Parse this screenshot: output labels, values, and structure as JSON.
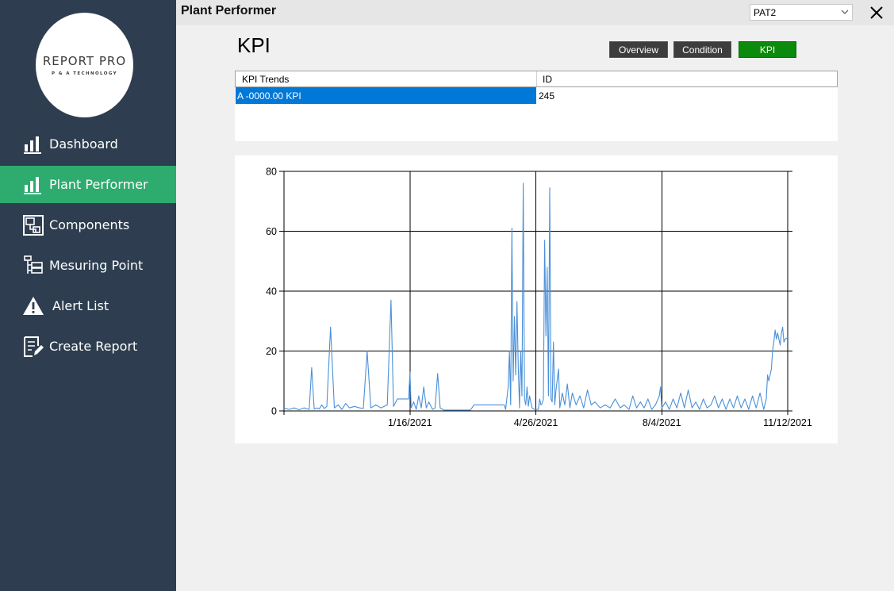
{
  "sidebar": {
    "logo": {
      "main": "REPORT PRO",
      "sub": "P & A TECHNOLOGY"
    },
    "items": [
      {
        "label": "Dashboard",
        "icon": "bar-chart-icon",
        "active": false
      },
      {
        "label": "Plant Performer",
        "icon": "bar-chart-icon",
        "active": true
      },
      {
        "label": "Components",
        "icon": "components-icon",
        "active": false
      },
      {
        "label": "Mesuring Point",
        "icon": "tree-list-icon",
        "active": false
      },
      {
        "label": "Alert List",
        "icon": "warning-icon",
        "active": false
      },
      {
        "label": "Create Report",
        "icon": "edit-report-icon",
        "active": false
      }
    ]
  },
  "titlebar": {
    "title": "Plant Performer",
    "combo_value": "PAT2"
  },
  "page": {
    "title": "KPI"
  },
  "buttons": {
    "overview": "Overview",
    "condition": "Condition",
    "kpi": "KPI"
  },
  "grid": {
    "headers": [
      "KPI Trends",
      "ID"
    ],
    "rows": [
      {
        "name": "A -0000.00 KPI",
        "id": "245"
      }
    ]
  },
  "colors": {
    "sidebar": "#2e3e50",
    "active": "#2eab6e",
    "kpi_button": "#0c8a0c",
    "series": "#4a90d9",
    "selection": "#0078d7"
  },
  "chart_data": {
    "type": "line",
    "ylim": [
      0,
      80
    ],
    "yticks": [
      0,
      20,
      40,
      60,
      80
    ],
    "xlim": [
      "2020-10-08",
      "2021-11-12"
    ],
    "xticks": [
      {
        "date": "2021-01-16",
        "label": "1/16/2021"
      },
      {
        "date": "2021-04-26",
        "label": "4/26/2021"
      },
      {
        "date": "2021-08-04",
        "label": "8/4/2021"
      },
      {
        "date": "2021-11-12",
        "label": "11/12/2021"
      }
    ],
    "grid": true,
    "series": [
      {
        "color": "#4a90d9",
        "points": [
          [
            "2020-10-08",
            1
          ],
          [
            "2020-10-12",
            0.5
          ],
          [
            "2020-10-16",
            1
          ],
          [
            "2020-10-20",
            0.4
          ],
          [
            "2020-10-24",
            1
          ],
          [
            "2020-10-28",
            0.5
          ],
          [
            "2020-10-30",
            14.5
          ],
          [
            "2020-11-01",
            0.6
          ],
          [
            "2020-11-03",
            1
          ],
          [
            "2020-11-05",
            0.7
          ],
          [
            "2020-11-07",
            2
          ],
          [
            "2020-11-09",
            0.8
          ],
          [
            "2020-11-11",
            1.5
          ],
          [
            "2020-11-14",
            28
          ],
          [
            "2020-11-17",
            1
          ],
          [
            "2020-11-20",
            2
          ],
          [
            "2020-11-23",
            0.5
          ],
          [
            "2020-11-26",
            2.5
          ],
          [
            "2020-11-29",
            1
          ],
          [
            "2020-12-03",
            1.5
          ],
          [
            "2020-12-07",
            1
          ],
          [
            "2020-12-10",
            0.8
          ],
          [
            "2020-12-13",
            20
          ],
          [
            "2020-12-16",
            1
          ],
          [
            "2020-12-20",
            2
          ],
          [
            "2020-12-24",
            1
          ],
          [
            "2020-12-29",
            2
          ],
          [
            "2021-01-01",
            37
          ],
          [
            "2021-01-03",
            1.5
          ],
          [
            "2021-01-06",
            4
          ],
          [
            "2021-01-15",
            4
          ],
          [
            "2021-01-16",
            13
          ],
          [
            "2021-01-17",
            1
          ],
          [
            "2021-01-19",
            3
          ],
          [
            "2021-01-21",
            0.5
          ],
          [
            "2021-01-23",
            5
          ],
          [
            "2021-01-25",
            1
          ],
          [
            "2021-01-27",
            8
          ],
          [
            "2021-01-29",
            1
          ],
          [
            "2021-01-31",
            3
          ],
          [
            "2021-02-03",
            0.5
          ],
          [
            "2021-02-05",
            1
          ],
          [
            "2021-02-07",
            12.5
          ],
          [
            "2021-02-09",
            1
          ],
          [
            "2021-02-12",
            0.3
          ],
          [
            "2021-02-22",
            0.3
          ],
          [
            "2021-03-05",
            0.3
          ],
          [
            "2021-03-08",
            2
          ],
          [
            "2021-04-01",
            2
          ],
          [
            "2021-04-02",
            0.5
          ],
          [
            "2021-04-04",
            8
          ],
          [
            "2021-04-05",
            20
          ],
          [
            "2021-04-06",
            2
          ],
          [
            "2021-04-07",
            61
          ],
          [
            "2021-04-08",
            10
          ],
          [
            "2021-04-09",
            31.5
          ],
          [
            "2021-04-10",
            12
          ],
          [
            "2021-04-11",
            36.5
          ],
          [
            "2021-04-12",
            15
          ],
          [
            "2021-04-13",
            1
          ],
          [
            "2021-04-14",
            20
          ],
          [
            "2021-04-15",
            5
          ],
          [
            "2021-04-16",
            76
          ],
          [
            "2021-04-17",
            4
          ],
          [
            "2021-04-18",
            2
          ],
          [
            "2021-04-19",
            8
          ],
          [
            "2021-04-20",
            1.5
          ],
          [
            "2021-04-21",
            5
          ],
          [
            "2021-04-23",
            1
          ],
          [
            "2021-04-25",
            0.5
          ],
          [
            "2021-04-28",
            0.5
          ],
          [
            "2021-04-29",
            4
          ],
          [
            "2021-04-30",
            2
          ],
          [
            "2021-05-01",
            2.5
          ],
          [
            "2021-05-02",
            4
          ],
          [
            "2021-05-03",
            57
          ],
          [
            "2021-05-04",
            25
          ],
          [
            "2021-05-05",
            48
          ],
          [
            "2021-05-06",
            5
          ],
          [
            "2021-05-07",
            74.5
          ],
          [
            "2021-05-08",
            4
          ],
          [
            "2021-05-09",
            3
          ],
          [
            "2021-05-10",
            23
          ],
          [
            "2021-05-11",
            2
          ],
          [
            "2021-05-12",
            7
          ],
          [
            "2021-05-14",
            14
          ],
          [
            "2021-05-15",
            1
          ],
          [
            "2021-05-17",
            6
          ],
          [
            "2021-05-19",
            2
          ],
          [
            "2021-05-21",
            9
          ],
          [
            "2021-05-23",
            1
          ],
          [
            "2021-05-25",
            6
          ],
          [
            "2021-05-28",
            2
          ],
          [
            "2021-05-31",
            5
          ],
          [
            "2021-06-03",
            1
          ],
          [
            "2021-06-06",
            7
          ],
          [
            "2021-06-09",
            2
          ],
          [
            "2021-06-12",
            3
          ],
          [
            "2021-06-16",
            1
          ],
          [
            "2021-06-20",
            2
          ],
          [
            "2021-06-24",
            1
          ],
          [
            "2021-06-28",
            4
          ],
          [
            "2021-07-02",
            1
          ],
          [
            "2021-07-05",
            2
          ],
          [
            "2021-07-09",
            0.5
          ],
          [
            "2021-07-12",
            5
          ],
          [
            "2021-07-15",
            1
          ],
          [
            "2021-07-18",
            3
          ],
          [
            "2021-07-21",
            1
          ],
          [
            "2021-07-24",
            4
          ],
          [
            "2021-07-27",
            0.5
          ],
          [
            "2021-07-30",
            2
          ],
          [
            "2021-08-02",
            5
          ],
          [
            "2021-08-03",
            8
          ],
          [
            "2021-08-04",
            1
          ],
          [
            "2021-08-07",
            3
          ],
          [
            "2021-08-10",
            0.5
          ],
          [
            "2021-08-13",
            4
          ],
          [
            "2021-08-16",
            1
          ],
          [
            "2021-08-19",
            6
          ],
          [
            "2021-08-22",
            1
          ],
          [
            "2021-08-25",
            7
          ],
          [
            "2021-08-28",
            1
          ],
          [
            "2021-08-31",
            3
          ],
          [
            "2021-09-03",
            0.5
          ],
          [
            "2021-09-06",
            4
          ],
          [
            "2021-09-09",
            1
          ],
          [
            "2021-09-12",
            2
          ],
          [
            "2021-09-15",
            5
          ],
          [
            "2021-09-18",
            1
          ],
          [
            "2021-09-21",
            4
          ],
          [
            "2021-09-24",
            0.5
          ],
          [
            "2021-09-27",
            4
          ],
          [
            "2021-09-30",
            1
          ],
          [
            "2021-10-03",
            5
          ],
          [
            "2021-10-06",
            1
          ],
          [
            "2021-10-09",
            4
          ],
          [
            "2021-10-12",
            0.5
          ],
          [
            "2021-10-15",
            5
          ],
          [
            "2021-10-18",
            1
          ],
          [
            "2021-10-21",
            6
          ],
          [
            "2021-10-24",
            0.5
          ],
          [
            "2021-10-26",
            4
          ],
          [
            "2021-10-27",
            12
          ],
          [
            "2021-10-28",
            10
          ],
          [
            "2021-10-30",
            14
          ],
          [
            "2021-10-31",
            20
          ],
          [
            "2021-11-01",
            23
          ],
          [
            "2021-11-02",
            27
          ],
          [
            "2021-11-03",
            24
          ],
          [
            "2021-11-04",
            26
          ],
          [
            "2021-11-06",
            22
          ],
          [
            "2021-11-07",
            26
          ],
          [
            "2021-11-08",
            28
          ],
          [
            "2021-11-09",
            23
          ],
          [
            "2021-11-10",
            24
          ],
          [
            "2021-11-12",
            24.5
          ]
        ]
      }
    ]
  }
}
